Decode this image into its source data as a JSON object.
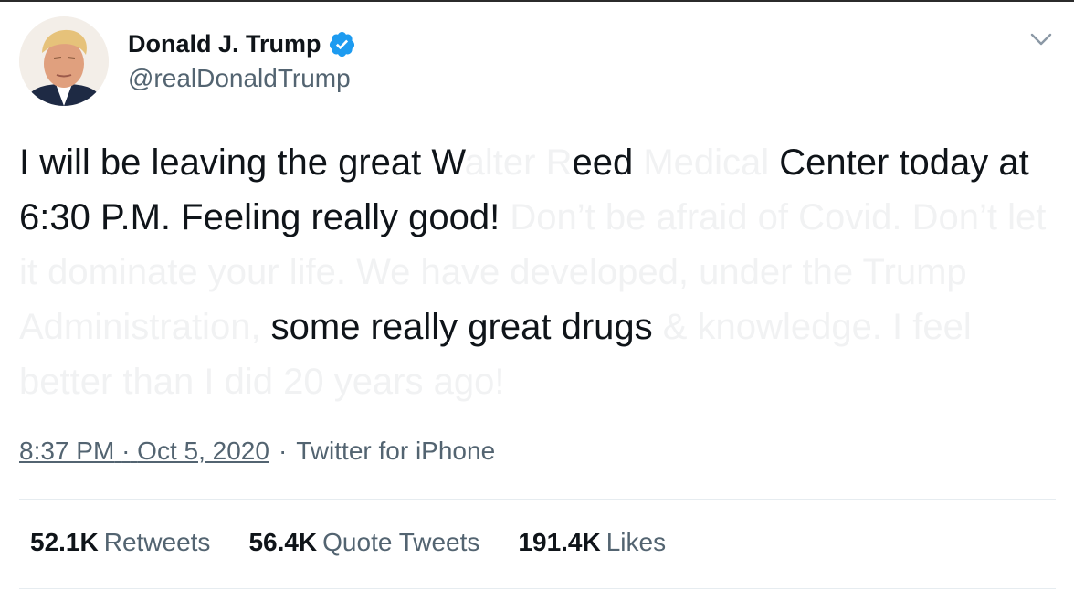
{
  "tweet": {
    "author": {
      "name": "Donald J. Trump",
      "handle": "@realDonaldTrump",
      "verified_icon": "verified-badge",
      "avatar_icon": "profile-photo"
    },
    "menu_icon": "chevron-down",
    "text": {
      "s1": "I will be leaving the great W",
      "s2": "alter R",
      "s3": "eed",
      "s4": " Medical ",
      "s5": "Center today at 6:30 P.M. Feeling really good! ",
      "s6": "Don’t be afraid of Covid. Don’t let it dominate your life. We have developed, under the Trump Administration, ",
      "s7": "some really great drugs ",
      "s8": "& knowledge. I feel better than I did 20 years ago!"
    },
    "meta": {
      "time": "8:37 PM",
      "dot1": "·",
      "date": "Oct 5, 2020",
      "dot2": "·",
      "source": "Twitter for iPhone"
    },
    "stats": [
      {
        "count": "52.1K",
        "label": "Retweets"
      },
      {
        "count": "56.4K",
        "label": "Quote Tweets"
      },
      {
        "count": "191.4K",
        "label": "Likes"
      }
    ],
    "colors": {
      "text": "#0f1419",
      "secondary": "#536471",
      "faded": "#f1f2f3",
      "verified": "#1d9bf0",
      "divider": "#e6ecf0"
    }
  }
}
